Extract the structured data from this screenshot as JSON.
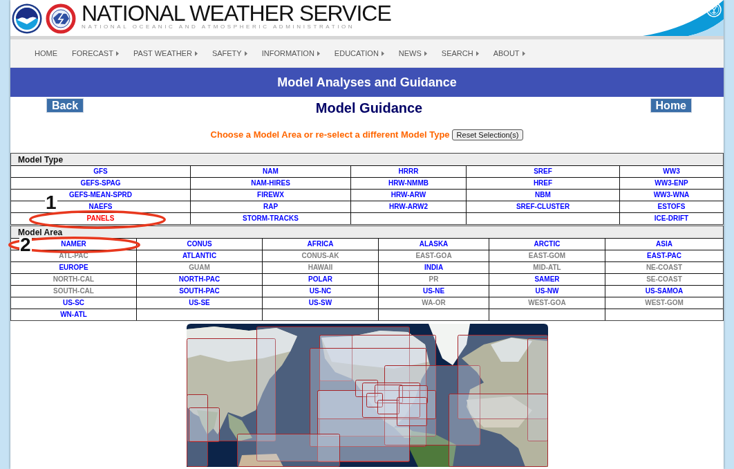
{
  "header": {
    "title": "NATIONAL WEATHER SERVICE",
    "subtitle": "NATIONAL OCEANIC AND ATMOSPHERIC ADMINISTRATION"
  },
  "nav": [
    {
      "label": "HOME",
      "has_menu": false
    },
    {
      "label": "FORECAST",
      "has_menu": true
    },
    {
      "label": "PAST WEATHER",
      "has_menu": true
    },
    {
      "label": "SAFETY",
      "has_menu": true
    },
    {
      "label": "INFORMATION",
      "has_menu": true
    },
    {
      "label": "EDUCATION",
      "has_menu": true
    },
    {
      "label": "NEWS",
      "has_menu": true
    },
    {
      "label": "SEARCH",
      "has_menu": true
    },
    {
      "label": "ABOUT",
      "has_menu": true
    }
  ],
  "banner": {
    "title": "Model Analyses and Guidance"
  },
  "page": {
    "back_button": "Back",
    "title": "Model Guidance",
    "home_button": "Home"
  },
  "instruction": {
    "text": "Choose a Model Area or re-select a different Model Type",
    "reset_button": "Reset Selection(s)"
  },
  "model_type": {
    "title": "Model Type",
    "columns": [
      {
        "items": [
          {
            "label": "GFS",
            "selected": false
          },
          {
            "label": "GEFS-SPAG",
            "selected": false
          },
          {
            "label": "GEFS-MEAN-SPRD",
            "selected": false
          },
          {
            "label": "NAEFS",
            "selected": false
          },
          {
            "label": "PANELS",
            "selected": true
          }
        ]
      },
      {
        "items": [
          {
            "label": "NAM",
            "selected": false
          },
          {
            "label": "NAM-HIRES",
            "selected": false
          },
          {
            "label": "FIREWX",
            "selected": false
          },
          {
            "label": "RAP",
            "selected": false
          },
          {
            "label": "STORM-TRACKS",
            "selected": false
          }
        ]
      },
      {
        "items": [
          {
            "label": "HRRR",
            "selected": false
          },
          {
            "label": "HRW-NMMB",
            "selected": false
          },
          {
            "label": "HRW-ARW",
            "selected": false
          },
          {
            "label": "HRW-ARW2",
            "selected": false
          }
        ]
      },
      {
        "items": [
          {
            "label": "SREF",
            "selected": false
          },
          {
            "label": "HREF",
            "selected": false
          },
          {
            "label": "NBM",
            "selected": false
          },
          {
            "label": "SREF-CLUSTER",
            "selected": false
          }
        ]
      },
      {
        "items": [
          {
            "label": "WW3",
            "selected": false
          },
          {
            "label": "WW3-ENP",
            "selected": false
          },
          {
            "label": "WW3-WNA",
            "selected": false
          },
          {
            "label": "ESTOFS",
            "selected": false
          },
          {
            "label": "ICE-DRIFT",
            "selected": false
          }
        ]
      }
    ]
  },
  "model_area": {
    "title": "Model Area",
    "items": [
      {
        "label": "NAMER",
        "selected": false,
        "disabled": false
      },
      {
        "label": "CONUS",
        "selected": false,
        "disabled": false
      },
      {
        "label": "AFRICA",
        "selected": false,
        "disabled": false
      },
      {
        "label": "ALASKA",
        "selected": false,
        "disabled": false
      },
      {
        "label": "ARCTIC",
        "selected": false,
        "disabled": false
      },
      {
        "label": "ASIA",
        "selected": false,
        "disabled": false
      },
      {
        "label": "ATL-PAC",
        "selected": false,
        "disabled": true
      },
      {
        "label": "ATLANTIC",
        "selected": false,
        "disabled": false
      },
      {
        "label": "CONUS-AK",
        "selected": false,
        "disabled": true
      },
      {
        "label": "EAST-GOA",
        "selected": false,
        "disabled": true
      },
      {
        "label": "EAST-GOM",
        "selected": false,
        "disabled": true
      },
      {
        "label": "EAST-PAC",
        "selected": false,
        "disabled": false
      },
      {
        "label": "EUROPE",
        "selected": false,
        "disabled": false
      },
      {
        "label": "GUAM",
        "selected": false,
        "disabled": true
      },
      {
        "label": "HAWAII",
        "selected": false,
        "disabled": true
      },
      {
        "label": "INDIA",
        "selected": false,
        "disabled": false
      },
      {
        "label": "MID-ATL",
        "selected": false,
        "disabled": true
      },
      {
        "label": "NE-COAST",
        "selected": false,
        "disabled": true
      },
      {
        "label": "NORTH-CAL",
        "selected": false,
        "disabled": true
      },
      {
        "label": "NORTH-PAC",
        "selected": false,
        "disabled": false
      },
      {
        "label": "POLAR",
        "selected": false,
        "disabled": false
      },
      {
        "label": "PR",
        "selected": false,
        "disabled": true
      },
      {
        "label": "SAMER",
        "selected": false,
        "disabled": false
      },
      {
        "label": "SE-COAST",
        "selected": false,
        "disabled": true
      },
      {
        "label": "SOUTH-CAL",
        "selected": false,
        "disabled": true
      },
      {
        "label": "SOUTH-PAC",
        "selected": false,
        "disabled": false
      },
      {
        "label": "US-NC",
        "selected": false,
        "disabled": false
      },
      {
        "label": "US-NE",
        "selected": false,
        "disabled": false
      },
      {
        "label": "US-NW",
        "selected": false,
        "disabled": false
      },
      {
        "label": "US-SAMOA",
        "selected": false,
        "disabled": false
      },
      {
        "label": "US-SC",
        "selected": false,
        "disabled": false
      },
      {
        "label": "US-SE",
        "selected": false,
        "disabled": false
      },
      {
        "label": "US-SW",
        "selected": false,
        "disabled": false
      },
      {
        "label": "WA-OR",
        "selected": false,
        "disabled": true
      },
      {
        "label": "WEST-GOA",
        "selected": false,
        "disabled": true
      },
      {
        "label": "WEST-GOM",
        "selected": false,
        "disabled": true
      },
      {
        "label": "WN-ATL",
        "selected": false,
        "disabled": false
      }
    ]
  },
  "annotations": [
    {
      "label": "1"
    },
    {
      "label": "2"
    }
  ]
}
